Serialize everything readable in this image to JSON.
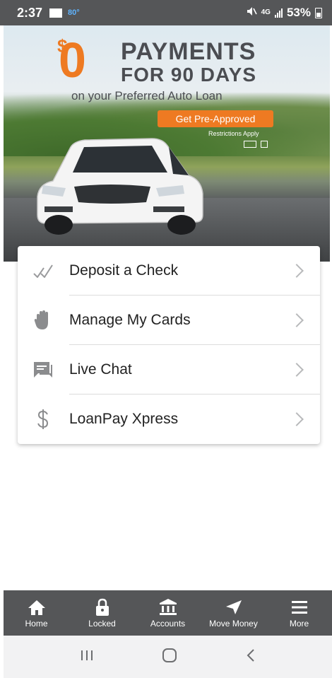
{
  "status_bar": {
    "time": "2:37",
    "temperature": "80°",
    "network": "4G",
    "battery": "53%"
  },
  "banner": {
    "dollar_sign": "$",
    "zero": "0",
    "line1": "PAYMENTS",
    "line2": "FOR 90 DAYS",
    "line3": "on your Preferred Auto Loan",
    "cta_label": "Get Pre-Approved",
    "restrictions": "Restrictions Apply"
  },
  "menu": {
    "items": [
      {
        "label": "Deposit a Check",
        "icon": "check-deposit-icon"
      },
      {
        "label": "Manage My Cards",
        "icon": "hand-icon"
      },
      {
        "label": "Live Chat",
        "icon": "chat-bubble-icon"
      },
      {
        "label": "LoanPay Xpress",
        "icon": "dollar-icon"
      }
    ]
  },
  "bottom_nav": {
    "items": [
      {
        "label": "Home",
        "icon": "home-icon"
      },
      {
        "label": "Locked",
        "icon": "lock-icon"
      },
      {
        "label": "Accounts",
        "icon": "bank-icon"
      },
      {
        "label": "Move Money",
        "icon": "send-icon"
      },
      {
        "label": "More",
        "icon": "menu-icon"
      }
    ]
  },
  "colors": {
    "accent": "#ee7a22",
    "nav_background": "#555658",
    "status_temp": "#5fb4ff"
  }
}
